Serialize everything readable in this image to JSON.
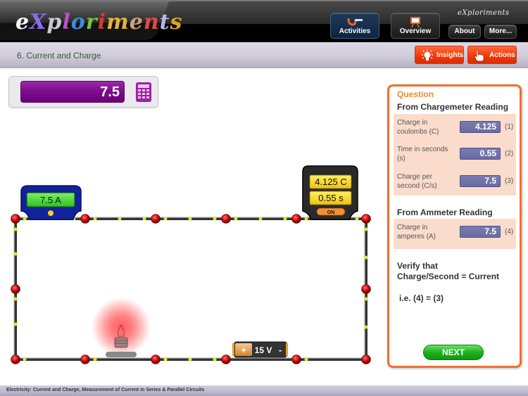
{
  "header": {
    "logo_letters": [
      "e",
      "X",
      "p",
      "l",
      "o",
      "r",
      "i",
      "m",
      "e",
      "n",
      "t",
      "s"
    ],
    "mini_logo": "eXploriments",
    "buttons": {
      "activities": "Activities",
      "overview": "Overview",
      "about": "About",
      "more": "More..."
    }
  },
  "subheader": {
    "page_title": "6. Current and Charge",
    "insights": "Insights",
    "actions": "Actions"
  },
  "calculator": {
    "display_value": "7.5"
  },
  "circuit": {
    "ammeter_reading": "7.5 A",
    "chargemeter_charge": "4.125 C",
    "chargemeter_time": "0.55 s",
    "chargemeter_switch": "ON",
    "battery_plus": "+",
    "battery_label": "15 V",
    "battery_minus": "-"
  },
  "question": {
    "title": "Question",
    "section1": "From Chargemeter Reading",
    "rows1": [
      {
        "label": "Charge in coulombs (C)",
        "value": "4.125",
        "num": "(1)"
      },
      {
        "label": "Time in seconds (s)",
        "value": "0.55",
        "num": "(2)"
      },
      {
        "label": "Charge per second (C/s)",
        "value": "7.5",
        "num": "(3)"
      }
    ],
    "section2": "From Ammeter Reading",
    "rows2": [
      {
        "label": "Charge in amperes (A)",
        "value": "7.5",
        "num": "(4)"
      }
    ],
    "verify_line1": "Verify that",
    "verify_line2": "Charge/Second = Current",
    "ie": "i.e. (4) = (3)",
    "next": "NEXT"
  },
  "footer": {
    "text": "Electricity: Current and Charge, Measurement of Current in Series & Parallel Circuits"
  },
  "colors": {
    "accent_orange": "#f07030",
    "calc_purple": "#7d0d8e",
    "next_green": "#1fb01f",
    "node_red": "#d01010"
  }
}
